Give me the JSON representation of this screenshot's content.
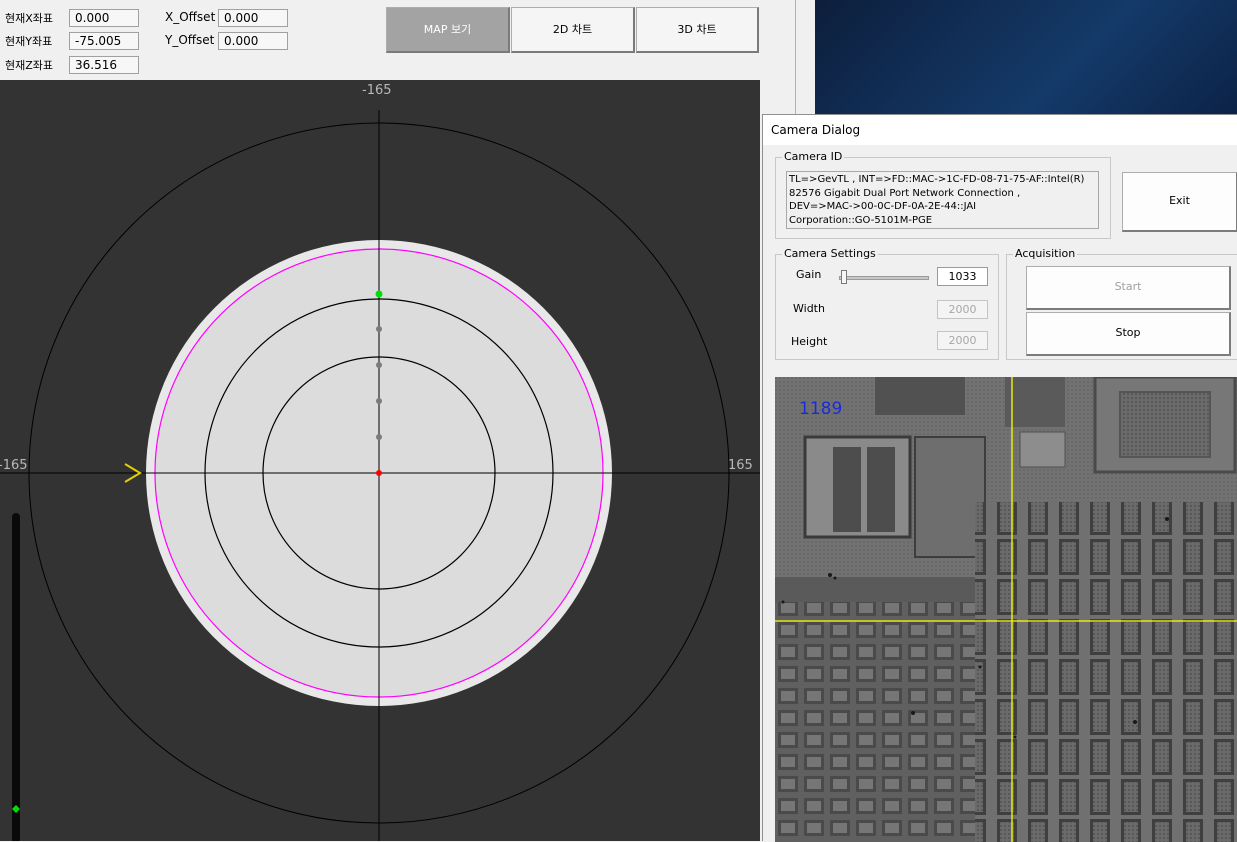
{
  "coords": {
    "x_label": "현재X좌표",
    "x_value": "0.000",
    "y_label": "현재Y좌표",
    "y_value": "-75.005",
    "z_label": "현재Z좌표",
    "z_value": "36.516"
  },
  "offsets": {
    "x_label": "X_Offset",
    "x_value": "0.000",
    "y_label": "Y_Offset",
    "y_value": "0.000"
  },
  "view_buttons": {
    "map": "MAP 보기",
    "chart2d": "2D 차트",
    "chart3d": "3D 차트",
    "active": "map"
  },
  "map": {
    "axis_top": "-165",
    "axis_left": "-165",
    "axis_right": "165",
    "colors": {
      "background": "#333333",
      "wafer": "#dcdcdc",
      "wafer_edge": "#e8e8e8",
      "edge_ring": "#ff00ff",
      "current_point": "#00e000",
      "origin_point": "#ff0000",
      "notch_marker": "#e0d000"
    },
    "icons": [
      "notch-arrow-icon",
      "z-slider-thumb-icon"
    ]
  },
  "camera_dialog": {
    "title": "Camera Dialog",
    "camera_id_group": "Camera ID",
    "camera_id_lines": [
      "TL=>GevTL , INT=>FD::MAC->1C-FD-08-71-75-AF::Intel(R)",
      "82576 Gigabit Dual Port Network Connection ,",
      "DEV=>MAC->00-0C-DF-0A-2E-44::JAI",
      "Corporation::GO-5101M-PGE"
    ],
    "exit_label": "Exit",
    "settings_group": "Camera Settings",
    "gain_label": "Gain",
    "gain_value": "1033",
    "width_label": "Width",
    "width_value": "2000",
    "height_label": "Height",
    "height_value": "2000",
    "acquisition_group": "Acquisition",
    "start_label": "Start",
    "stop_label": "Stop",
    "frame_counter": "1189",
    "crosshair_color": "#ffff00"
  }
}
